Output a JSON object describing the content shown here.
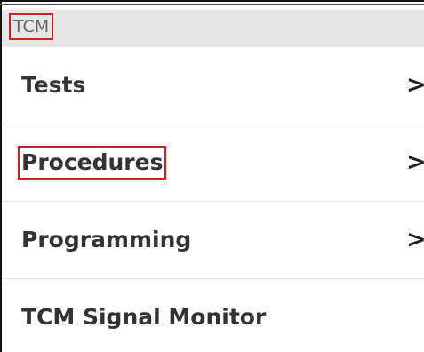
{
  "header": {
    "title": "TCM"
  },
  "menu": {
    "items": [
      {
        "label": "Tests",
        "chevron": ">"
      },
      {
        "label": "Procedures",
        "chevron": ">"
      },
      {
        "label": "Programming",
        "chevron": ">"
      },
      {
        "label": "TCM Signal Monitor"
      }
    ]
  },
  "highlight_color": "#cc2222"
}
